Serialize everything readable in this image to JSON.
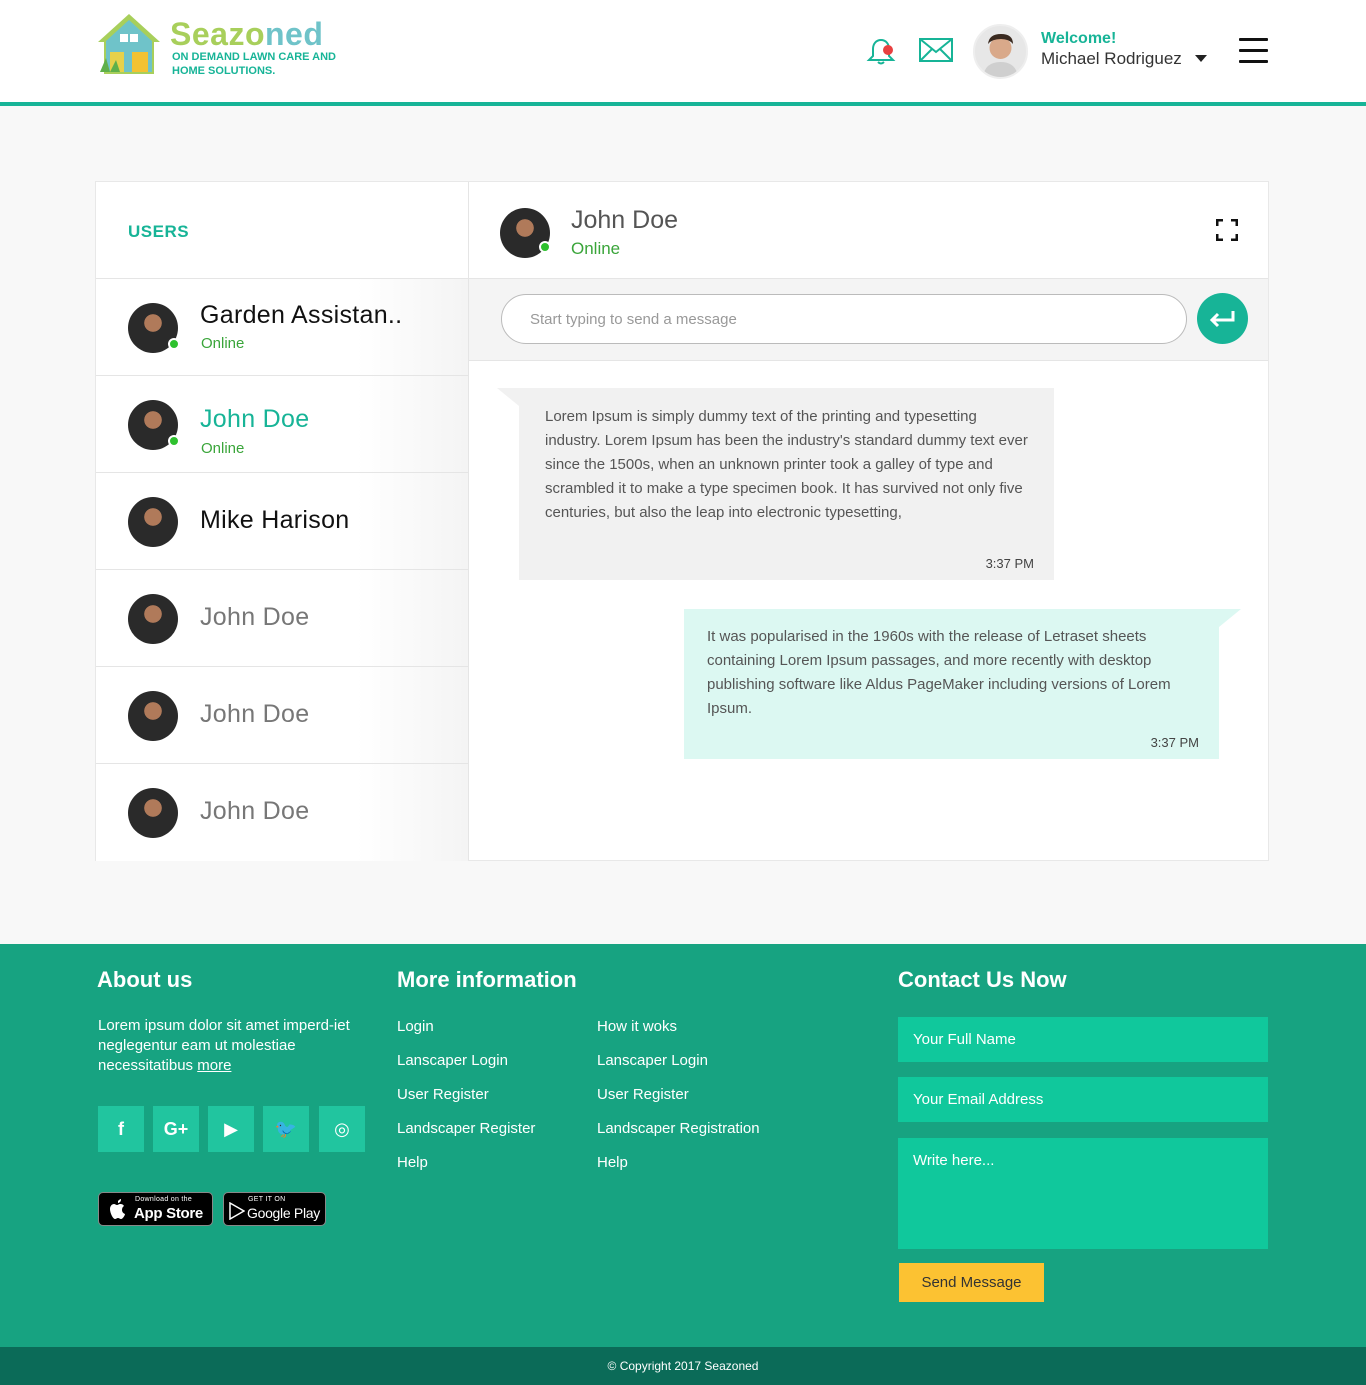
{
  "brand": {
    "name_part1": "Seazo",
    "name_part2": "ned",
    "tagline": "ON DEMAND LAWN CARE AND HOME SOLUTIONS."
  },
  "header": {
    "welcome": "Welcome!",
    "user_name": "Michael Rodriguez"
  },
  "users_panel": {
    "title": "USERS",
    "users": [
      {
        "name": "Garden Assistan..",
        "status": "Online"
      },
      {
        "name": "John Doe",
        "status": "Online"
      },
      {
        "name": "Mike Harison",
        "status": ""
      },
      {
        "name": "John Doe",
        "status": ""
      },
      {
        "name": "John Doe",
        "status": ""
      },
      {
        "name": "John Doe",
        "status": ""
      }
    ]
  },
  "chat": {
    "contact_name": "John Doe",
    "contact_status": "Online",
    "input_placeholder": "Start typing to send a message",
    "messages": [
      {
        "direction": "in",
        "text": "Lorem Ipsum is simply dummy text of the printing and typesetting industry. Lorem Ipsum has been the industry's standard dummy text ever since the 1500s, when an unknown printer took a galley of type and scrambled it to make a type specimen book. It has survived not only five centuries, but also the leap into electronic typesetting,",
        "time": "3:37 PM"
      },
      {
        "direction": "out",
        "text": "It was popularised in the 1960s with the release of Letraset sheets containing Lorem Ipsum passages, and more recently with desktop publishing software like Aldus PageMaker including versions of Lorem Ipsum.",
        "time": "3:37 PM"
      }
    ]
  },
  "footer": {
    "about": {
      "title": "About us",
      "text": "Lorem ipsum dolor sit amet imperd-iet neglegentur eam ut molestiae necessitatibus",
      "more": "more"
    },
    "more_info": {
      "title": "More information",
      "col1": [
        "Login",
        "Lanscaper Login",
        "User Register",
        "Landscaper Register",
        "Help"
      ],
      "col2": [
        "How it woks",
        "Lanscaper Login",
        "User Register",
        "Landscaper Registration",
        "Help"
      ]
    },
    "social_icons": [
      "facebook-icon",
      "google-plus-icon",
      "youtube-icon",
      "twitter-icon",
      "instagram-icon"
    ],
    "social_glyphs": [
      "f",
      "G+",
      "▶",
      "🐦",
      "◎"
    ],
    "app_store": {
      "small": "Download on the",
      "big": "App Store"
    },
    "google_play": {
      "small": "GET IT ON",
      "big": "Google Play"
    },
    "contact": {
      "title": "Contact Us Now",
      "name_placeholder": "Your Full Name",
      "email_placeholder": "Your Email Address",
      "message_placeholder": "Write here...",
      "send_label": "Send Message"
    },
    "copyright": "© Copyright 2017 Seazoned"
  },
  "colors": {
    "accent": "#17b497",
    "footer_bg": "#17a381",
    "online": "#3aa53a",
    "send_button": "#fcc232"
  }
}
